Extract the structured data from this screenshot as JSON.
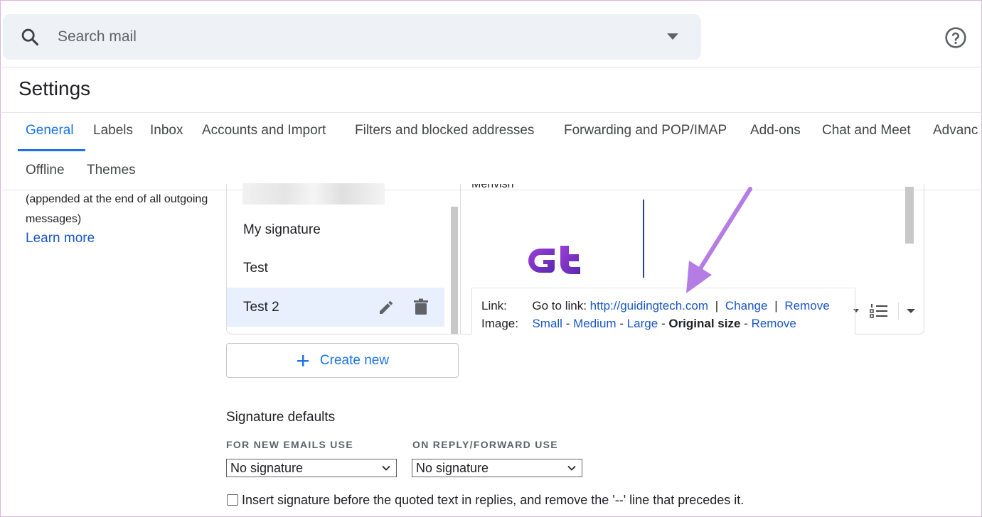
{
  "search": {
    "placeholder": "Search mail"
  },
  "page_title": "Settings",
  "tabs": [
    {
      "label": "General",
      "active": true
    },
    {
      "label": "Labels"
    },
    {
      "label": "Inbox"
    },
    {
      "label": "Accounts and Import"
    },
    {
      "label": "Filters and blocked addresses"
    },
    {
      "label": "Forwarding and POP/IMAP"
    },
    {
      "label": "Add-ons"
    },
    {
      "label": "Chat and Meet"
    },
    {
      "label": "Advanc"
    },
    {
      "label": "Offline"
    },
    {
      "label": "Themes"
    }
  ],
  "signature": {
    "description_line1": "(appended at the end of all outgoing",
    "description_line2": "messages)",
    "learn_more": "Learn more",
    "items": [
      "My signature",
      "Test",
      "Test 2"
    ],
    "selected_index": 2,
    "editor_name": "Mehvish",
    "link_label": "Link:",
    "go_to_link": "Go to link:",
    "link_url": "http://guidingtech.com",
    "sep": "|",
    "change": "Change",
    "remove_link": "Remove",
    "image_label": "Image:",
    "sizes": [
      "Small",
      "Medium",
      "Large",
      "Original size"
    ],
    "dash": "-",
    "remove_image": "Remove",
    "create_new": "Create new"
  },
  "defaults": {
    "title": "Signature defaults",
    "new_emails_label": "FOR NEW EMAILS USE",
    "new_emails_value": "No signature",
    "reply_label": "ON REPLY/FORWARD USE",
    "reply_value": "No signature",
    "insert_before_label": "Insert signature before the quoted text in replies, and remove the '--' line that precedes it."
  },
  "icons": {
    "search": "search-icon",
    "help": "help-circle-icon",
    "edit": "pencil-icon",
    "delete": "trash-icon",
    "list": "numbered-list-icon",
    "add": "plus-icon"
  },
  "colors": {
    "accent": "#1a73e8",
    "annotation_arrow": "#b57ce6",
    "logo": "#7b35c9"
  }
}
